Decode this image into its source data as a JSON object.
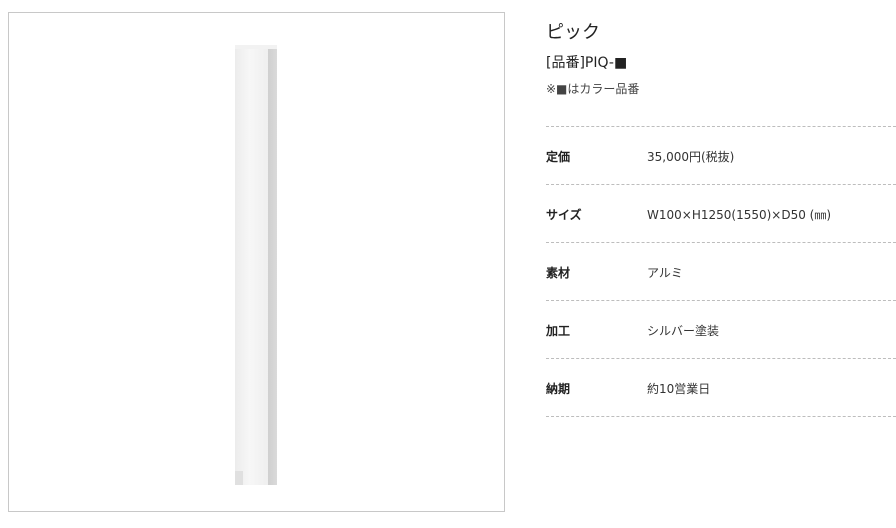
{
  "product": {
    "name": "ピック",
    "code": "[品番]PIQ-■",
    "note": "※■はカラー品番"
  },
  "specs": [
    {
      "label": "定価",
      "value": "35,000円(税抜)"
    },
    {
      "label": "サイズ",
      "value": "W100×H1250(1550)×D50 (㎜)"
    },
    {
      "label": "素材",
      "value": "アルミ"
    },
    {
      "label": "加工",
      "value": "シルバー塗装"
    },
    {
      "label": "納期",
      "value": "約10営業日"
    }
  ]
}
